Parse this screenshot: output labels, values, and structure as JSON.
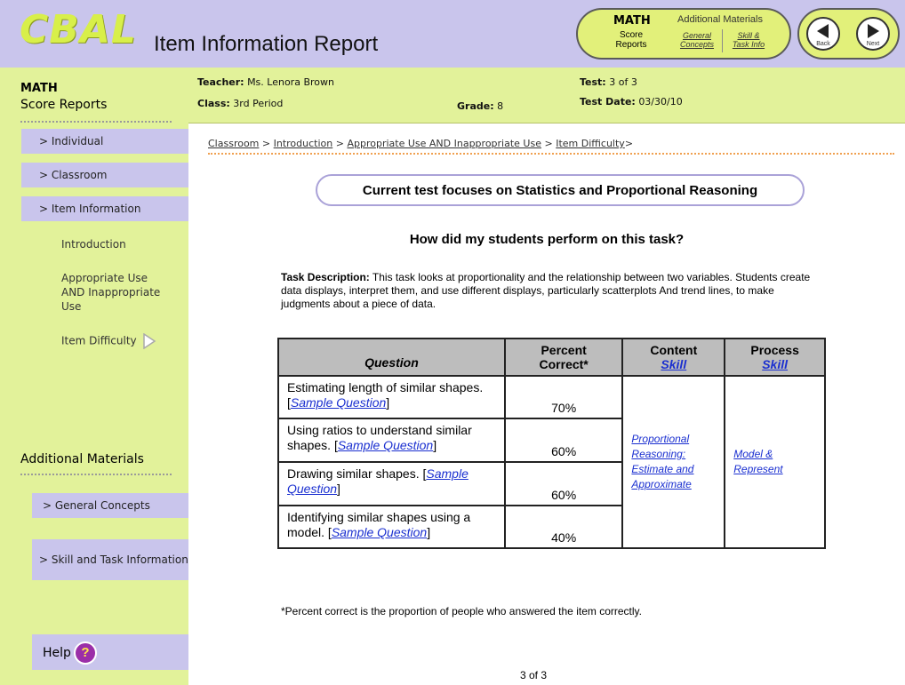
{
  "header": {
    "logo": "CBAL",
    "title": "Item Information Report",
    "math_menu": {
      "title": "MATH",
      "score_reports_line1": "Score",
      "score_reports_line2": "Reports",
      "additional_materials": "Additional Materials",
      "general_concepts_line1": "General",
      "general_concepts_line2": "Concepts",
      "skill_task_line1": "Skill &",
      "skill_task_line2": "Task Info"
    },
    "nav": {
      "back": "Back",
      "next": "Next"
    }
  },
  "sidebar": {
    "math": "MATH",
    "score_reports": "Score Reports",
    "items": [
      {
        "label": "> Individual"
      },
      {
        "label": "> Classroom"
      },
      {
        "label": "> Item Information"
      }
    ],
    "subitems": [
      {
        "label": "Introduction"
      },
      {
        "label": "Appropriate Use AND Inappropriate Use"
      },
      {
        "label": "Item Difficulty"
      }
    ],
    "additional_materials": "Additional Materials",
    "additional_items": [
      {
        "label": "> General  Concepts"
      },
      {
        "label": "> Skill and Task Information"
      }
    ],
    "help": "Help"
  },
  "info": {
    "teacher_label": "Teacher:",
    "teacher_value": "Ms. Lenora Brown",
    "class_label": "Class:",
    "class_value": "3rd Period",
    "grade_label": "Grade:",
    "grade_value": "8",
    "test_label": "Test:",
    "test_value": "3 of 3",
    "test_date_label": "Test Date:",
    "test_date_value": "03/30/10"
  },
  "breadcrumb": {
    "items": [
      "Classroom",
      "Introduction",
      "Appropriate Use AND Inappropriate Use",
      "Item Difficulty"
    ],
    "separator": ">"
  },
  "focus": "Current  test focuses on Statistics and Proportional Reasoning",
  "question_heading": "How did my students perform on this task?",
  "task": {
    "label": "Task Description:",
    "text": " This task looks at proportionality and the relationship between two variables. Students create data displays, interpret them, and use different displays, particularly scatterplots And trend lines, to make judgments about a piece of data."
  },
  "table": {
    "headers": {
      "question": "Question",
      "percent_line1": "Percent",
      "percent_line2": "Correct*",
      "content_line1": "Content",
      "content_line2": "Skill",
      "process_line1": "Process",
      "process_line2": "Skill"
    },
    "sample_label": "Sample Question",
    "rows": [
      {
        "question": "Estimating length of similar shapes. ",
        "percent": "70%"
      },
      {
        "question": "Using ratios to understand similar shapes. ",
        "percent": "60%"
      },
      {
        "question": "Drawing similar shapes. ",
        "percent": "60%"
      },
      {
        "question": "Identifying similar shapes using a model. ",
        "percent": "40%"
      }
    ],
    "content_skill": "Proportional Reasoning: Estimate and Approximate",
    "process_skill": "Model & Represent"
  },
  "footnote": "*Percent correct is the proportion of people who answered the item correctly.",
  "page": "3 of 3"
}
